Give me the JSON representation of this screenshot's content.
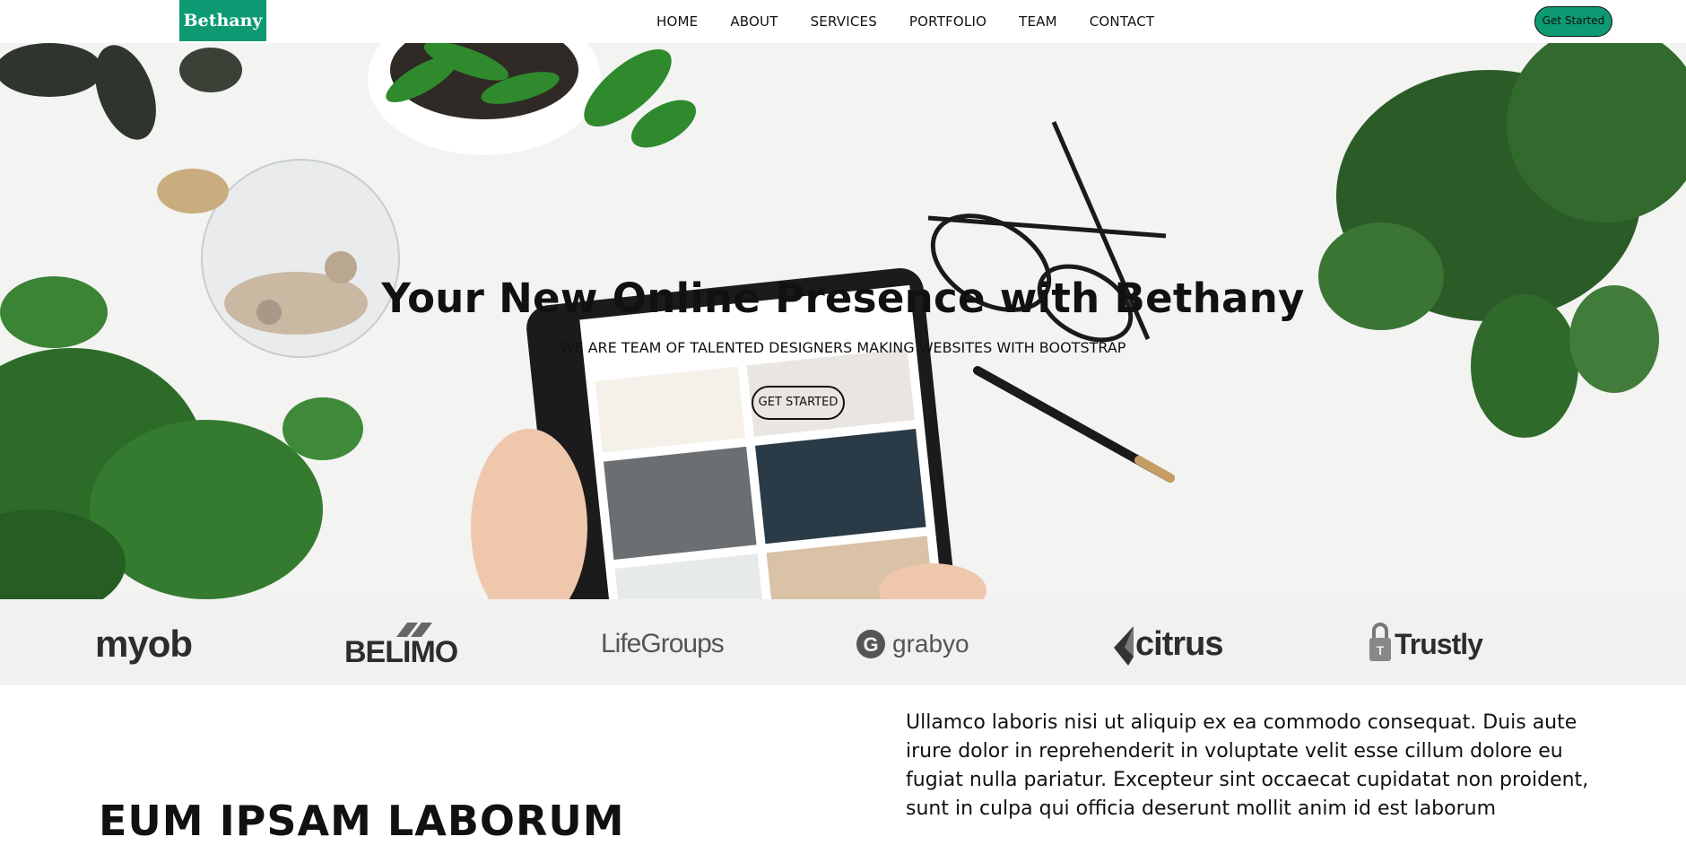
{
  "header": {
    "logo": "Bethany",
    "nav": [
      "HOME",
      "ABOUT",
      "SERVICES",
      "PORTFOLIO",
      "TEAM",
      "CONTACT"
    ],
    "cta": "Get Started"
  },
  "hero": {
    "title": "Your New Online Presence with Bethany",
    "subtitle": "WE ARE TEAM OF TALENTED DESIGNERS MAKING WEBSITES WITH BOOTSTRAP",
    "button": "GET STARTED"
  },
  "clients": [
    "myob",
    "BELIMO",
    "LifeGroups",
    "grabyo",
    "citrus",
    "Trustly"
  ],
  "about": {
    "heading": "EUM IPSAM LABORUM",
    "paragraph": "Ullamco laboris nisi ut aliquip ex ea commodo consequat. Duis aute irure dolor in reprehenderit in voluptate velit esse cillum dolore eu fugiat nulla pariatur. Excepteur sint occaecat cupidatat non proident, sunt in culpa qui officia deserunt mollit anim id est laborum"
  },
  "colors": {
    "accent": "#0d9a72",
    "clients_bg": "#f1f1f1"
  }
}
